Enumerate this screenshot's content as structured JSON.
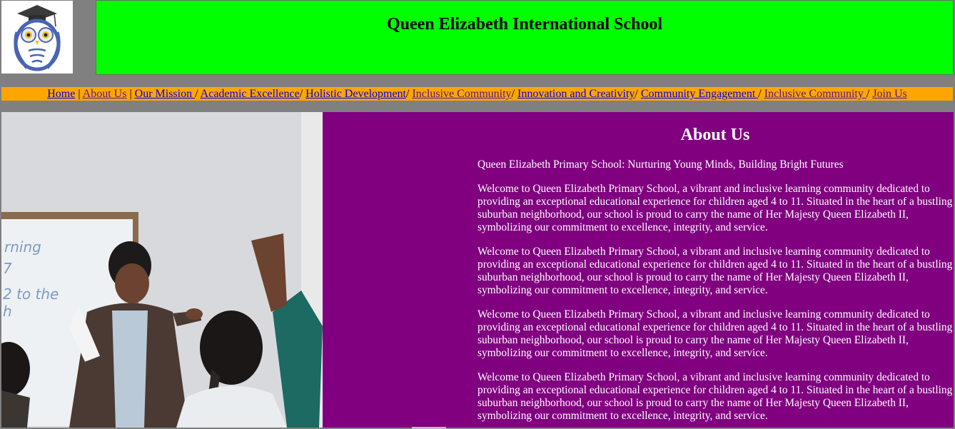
{
  "header": {
    "title": "Queen Elizabeth International School",
    "logo_icon": "owl-graduation-cap-logo"
  },
  "nav": {
    "links": [
      {
        "label": "Home",
        "color": "#0000ee"
      },
      {
        "label": "About Us",
        "color": "#551a8b"
      },
      {
        "label": "Our Mission ",
        "color": "#0000ee"
      },
      {
        "label": "Academic Excellence",
        "color": "#0000ee"
      },
      {
        "label": "Holistic Development",
        "color": "#0000ee"
      },
      {
        "label": "Inclusive Community",
        "color": "#551a8b"
      },
      {
        "label": "Innovation and Creativity",
        "color": "#0000ee"
      },
      {
        "label": "Community Engagement ",
        "color": "#0000ee"
      },
      {
        "label": "Inclusive Community ",
        "color": "#551a8b"
      },
      {
        "label": "Join Us",
        "color": "#551a8b"
      }
    ],
    "separators": [
      " | ",
      " | ",
      "/ ",
      "/ ",
      "/ ",
      "/ ",
      "/ ",
      "/ ",
      "/ "
    ]
  },
  "hero": {
    "image_subject": "teacher-classroom-photo"
  },
  "about": {
    "heading": "About Us",
    "tagline": "Queen Elizabeth Primary School: Nurturing Young Minds, Building Bright Futures",
    "paragraphs": [
      "Welcome to Queen Elizabeth Primary School, a vibrant and inclusive learning community dedicated to providing an exceptional educational experience for children aged 4 to 11. Situated in the heart of a bustling suburban neighborhood, our school is proud to carry the name of Her Majesty Queen Elizabeth II, symbolizing our commitment to excellence, integrity, and service.",
      "Welcome to Queen Elizabeth Primary School, a vibrant and inclusive learning community dedicated to providing an exceptional educational experience for children aged 4 to 11. Situated in the heart of a bustling suburban neighborhood, our school is proud to carry the name of Her Majesty Queen Elizabeth II, symbolizing our commitment to excellence, integrity, and service.",
      "Welcome to Queen Elizabeth Primary School, a vibrant and inclusive learning community dedicated to providing an exceptional educational experience for children aged 4 to 11. Situated in the heart of a bustling suburban neighborhood, our school is proud to carry the name of Her Majesty Queen Elizabeth II, symbolizing our commitment to excellence, integrity, and service.",
      "Welcome to Queen Elizabeth Primary School, a vibrant and inclusive learning community dedicated to providing an exceptional educational experience for children aged 4 to 11. Situated in the heart of a bustling suburban neighborhood, our school is proud to carry the name of Her Majesty Queen Elizabeth II, symbolizing our commitment to excellence, integrity, and service."
    ]
  },
  "colors": {
    "page_bg": "#808080",
    "header_bg": "#00ff00",
    "nav_bg": "#ffa500",
    "about_bg": "#800080",
    "about_text": "#ffffff"
  }
}
